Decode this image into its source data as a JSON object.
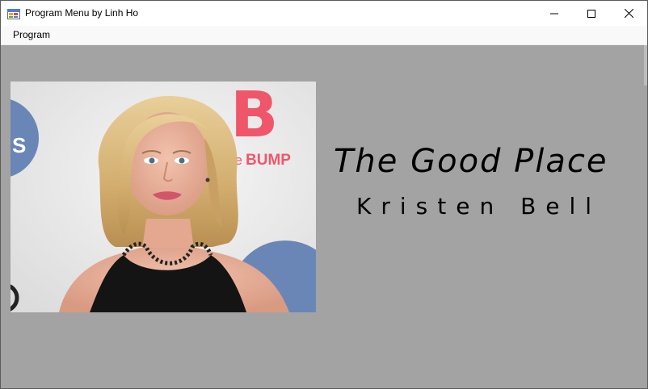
{
  "window": {
    "title": "Program Menu by Linh Ho",
    "icon": "app-form-icon",
    "buttons": {
      "minimize_icon": "minimize-icon",
      "maximize_icon": "maximize-icon",
      "close_icon": "close-icon"
    }
  },
  "menubar": {
    "items": [
      {
        "label": "Program"
      }
    ]
  },
  "content": {
    "photo_description_icon": "portrait-photo",
    "photo_text": {
      "logo_letter": "B",
      "logo_word_prefix": "he",
      "logo_word": "BUMP",
      "left_letters": "S"
    },
    "show_title": "The Good Place",
    "actor_name": "Kristen Bell"
  },
  "colors": {
    "background": "#a3a3a3",
    "titlebar": "#ffffff",
    "menubar": "#f9f9f9",
    "text": "#000000",
    "logo_pink": "#f0566a",
    "logo_blue": "#6a86b6"
  }
}
